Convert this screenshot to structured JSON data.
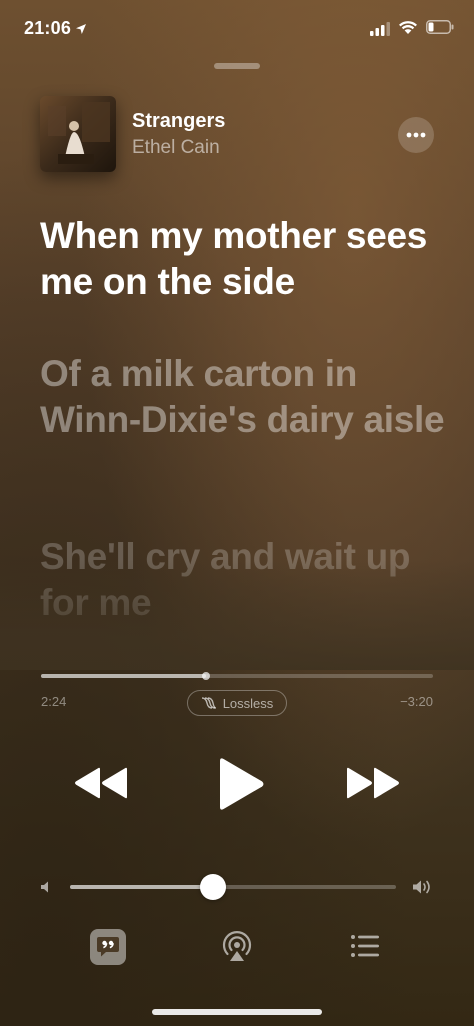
{
  "status_bar": {
    "time": "21:06",
    "location_icon": "location-arrow-icon",
    "signal_icon": "cellular-signal-icon",
    "wifi_icon": "wifi-icon",
    "battery_icon": "battery-icon"
  },
  "now_playing": {
    "title": "Strangers",
    "artist": "Ethel Cain",
    "artwork_icon": "album-artwork"
  },
  "lyrics": {
    "active_line": "When my mother sees me on the side",
    "next_line": "Of a milk carton in Winn-Dixie's dairy aisle",
    "later_line": "She'll cry and wait up for me"
  },
  "playback": {
    "elapsed": "2:24",
    "remaining": "−3:20",
    "progress": 0.42,
    "quality_badge": "Lossless"
  },
  "volume": {
    "level": 0.44
  },
  "colors": {
    "background_top": "#6e5030",
    "background_bottom": "#332814",
    "primary_text": "#ffffff"
  }
}
